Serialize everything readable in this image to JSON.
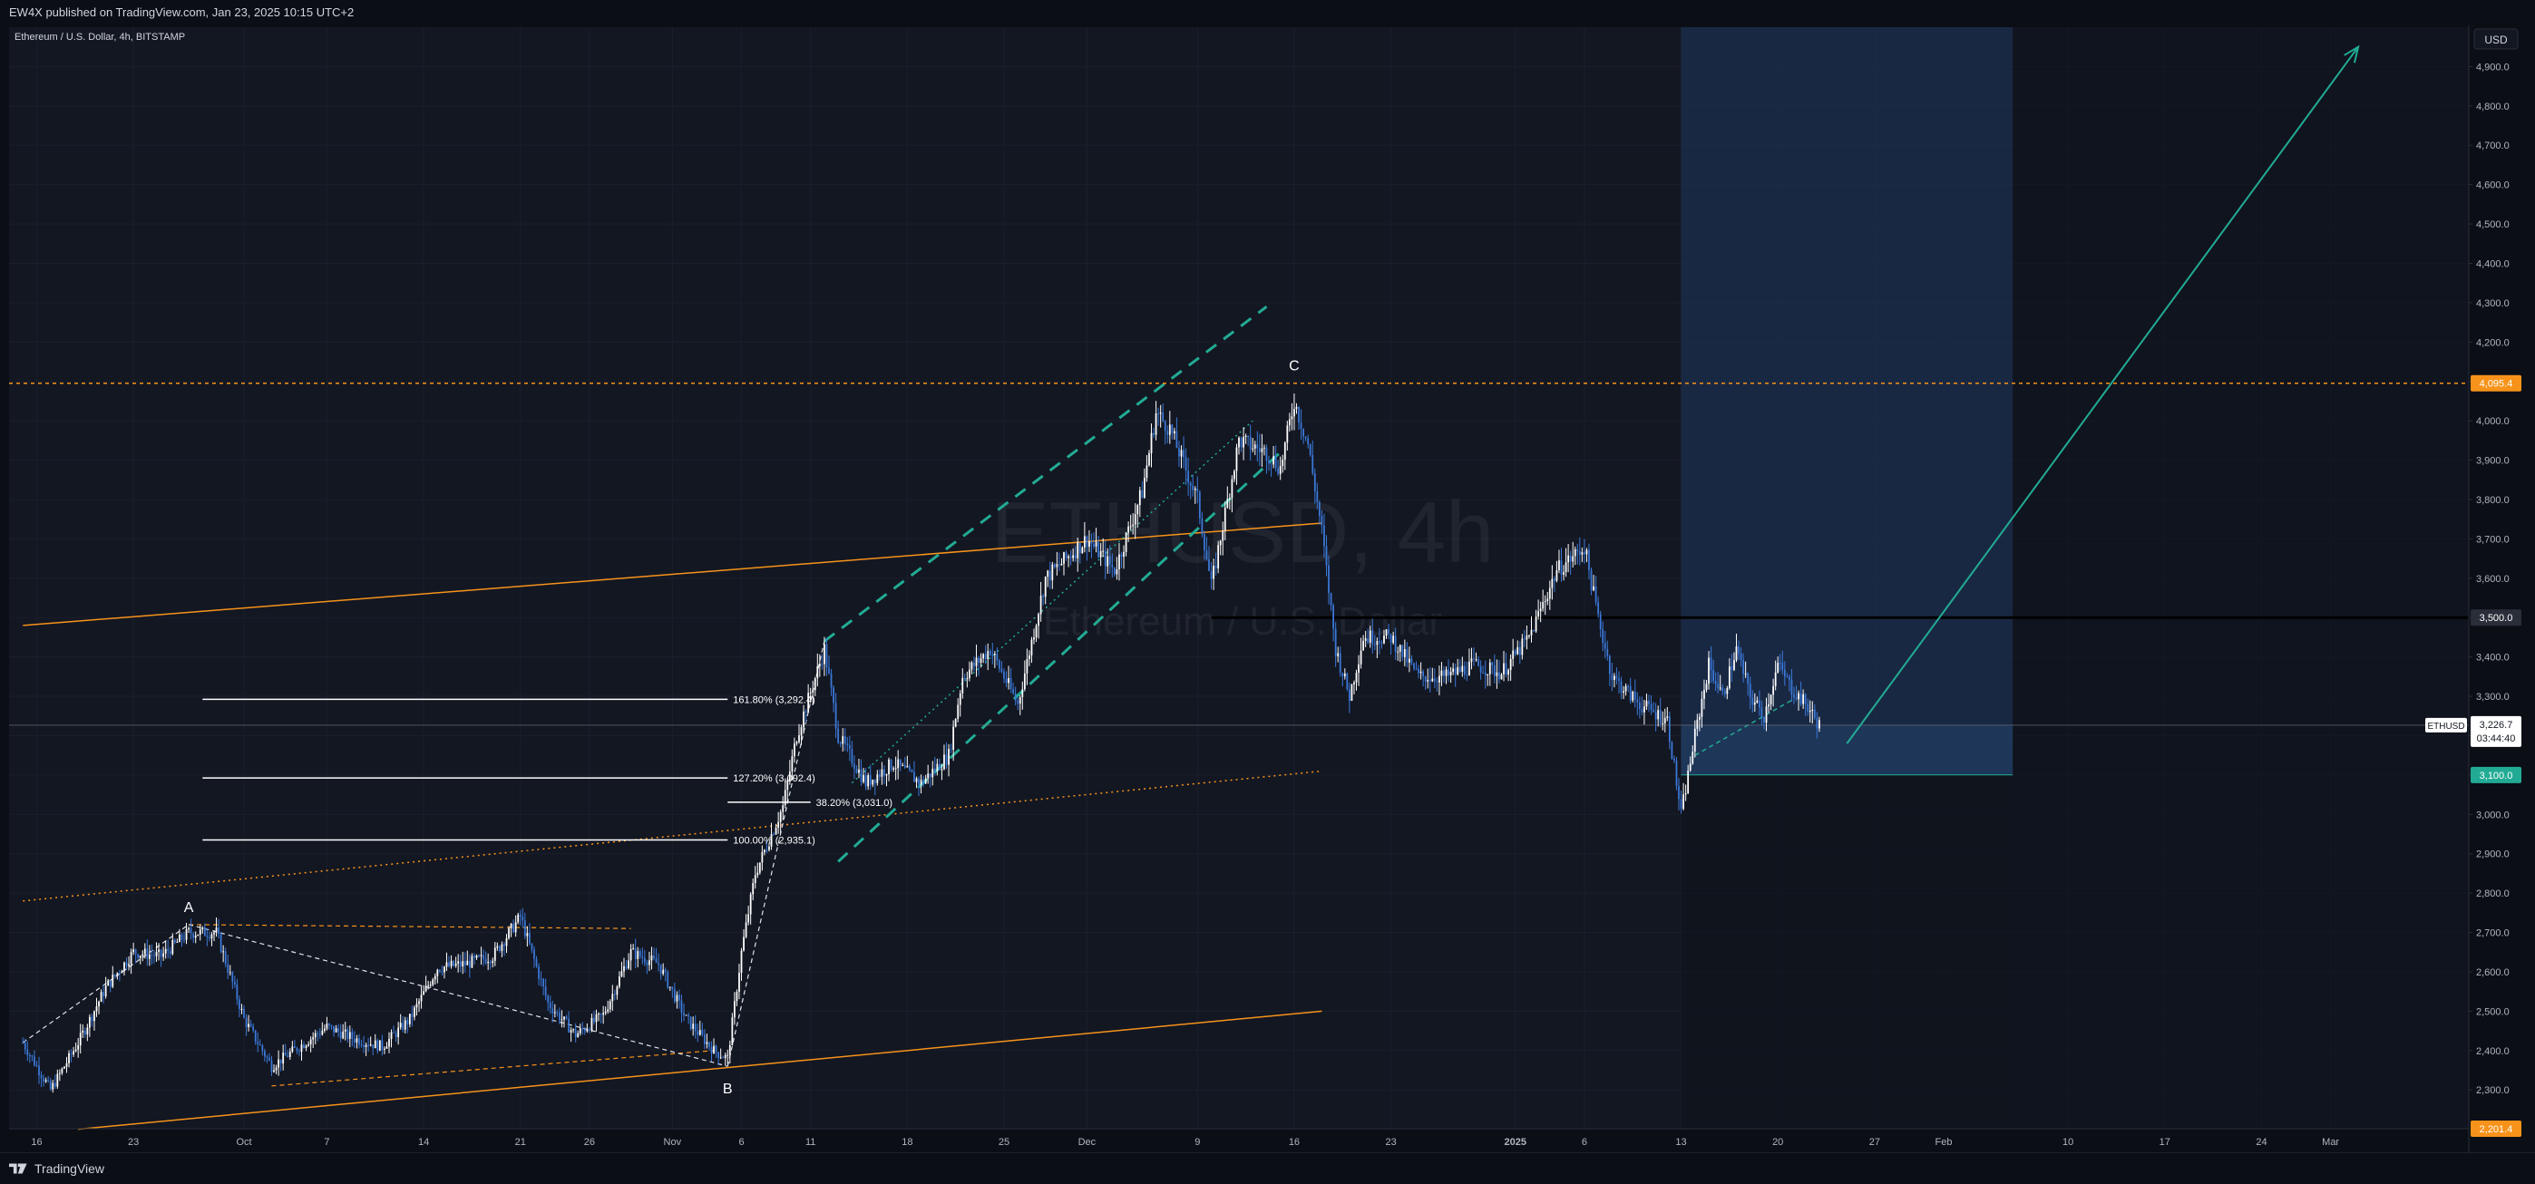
{
  "header": {
    "publish_line": "EW4X published on TradingView.com, Jan 23, 2025 10:15 UTC+2",
    "symbol_legend": "Ethereum / U.S. Dollar, 4h, BITSTAMP"
  },
  "watermark": {
    "ticker": "ETHUSD, 4h",
    "name": "Ethereum / U.S. Dollar"
  },
  "footer": {
    "brand": "TradingView"
  },
  "colors": {
    "background": "#131722",
    "candle": "#ffffff",
    "candle_alt": "#3b78d8",
    "orange": "#f7931a",
    "teal": "#22ab94",
    "grid": "#1a1f2b",
    "zone": "#1c2f4d"
  },
  "chart_data": {
    "type": "candlestick",
    "symbol": "ETHUSD",
    "timeframe": "4h",
    "currency": "USD",
    "ylim": [
      2201.4,
      5000
    ],
    "y_ticks": [
      "2,300.0",
      "2,400.0",
      "2,500.0",
      "2,600.0",
      "2,700.0",
      "2,800.0",
      "2,900.0",
      "3,000.0",
      "3,100.0",
      "3,200.0",
      "3,300.0",
      "3,400.0",
      "3,500.0",
      "3,600.0",
      "3,700.0",
      "3,800.0",
      "3,900.0",
      "4,000.0",
      "4,100.0",
      "4,200.0",
      "4,300.0",
      "4,400.0",
      "4,500.0",
      "4,600.0",
      "4,700.0",
      "4,800.0",
      "4,900.0"
    ],
    "x_ticks": [
      {
        "label": "16",
        "date": "2024-09-16"
      },
      {
        "label": "23",
        "date": "2024-09-23"
      },
      {
        "label": "Oct",
        "date": "2024-10-01"
      },
      {
        "label": "7",
        "date": "2024-10-07"
      },
      {
        "label": "14",
        "date": "2024-10-14"
      },
      {
        "label": "21",
        "date": "2024-10-21"
      },
      {
        "label": "26",
        "date": "2024-10-26"
      },
      {
        "label": "Nov",
        "date": "2024-11-01"
      },
      {
        "label": "6",
        "date": "2024-11-06"
      },
      {
        "label": "11",
        "date": "2024-11-11"
      },
      {
        "label": "18",
        "date": "2024-11-18"
      },
      {
        "label": "25",
        "date": "2024-11-25"
      },
      {
        "label": "Dec",
        "date": "2024-12-01"
      },
      {
        "label": "9",
        "date": "2024-12-09"
      },
      {
        "label": "16",
        "date": "2024-12-16"
      },
      {
        "label": "23",
        "date": "2024-12-23"
      },
      {
        "label": "2025",
        "date": "2025-01-01"
      },
      {
        "label": "6",
        "date": "2025-01-06"
      },
      {
        "label": "13",
        "date": "2025-01-13"
      },
      {
        "label": "20",
        "date": "2025-01-20"
      },
      {
        "label": "27",
        "date": "2025-01-27"
      },
      {
        "label": "Feb",
        "date": "2025-02-01"
      },
      {
        "label": "10",
        "date": "2025-02-10"
      },
      {
        "label": "17",
        "date": "2025-02-17"
      },
      {
        "label": "24",
        "date": "2025-02-24"
      },
      {
        "label": "Mar",
        "date": "2025-03-01"
      }
    ],
    "price_path": [
      [
        "2024-09-15",
        2420
      ],
      [
        "2024-09-17",
        2300
      ],
      [
        "2024-09-19",
        2420
      ],
      [
        "2024-09-21",
        2560
      ],
      [
        "2024-09-23",
        2650
      ],
      [
        "2024-09-25",
        2640
      ],
      [
        "2024-09-27",
        2700
      ],
      [
        "2024-09-29",
        2700
      ],
      [
        "2024-10-01",
        2480
      ],
      [
        "2024-10-03",
        2360
      ],
      [
        "2024-10-05",
        2410
      ],
      [
        "2024-10-07",
        2460
      ],
      [
        "2024-10-09",
        2430
      ],
      [
        "2024-10-11",
        2410
      ],
      [
        "2024-10-13",
        2480
      ],
      [
        "2024-10-15",
        2610
      ],
      [
        "2024-10-17",
        2620
      ],
      [
        "2024-10-19",
        2640
      ],
      [
        "2024-10-21",
        2740
      ],
      [
        "2024-10-23",
        2520
      ],
      [
        "2024-10-25",
        2440
      ],
      [
        "2024-10-27",
        2490
      ],
      [
        "2024-10-29",
        2650
      ],
      [
        "2024-10-31",
        2620
      ],
      [
        "2024-11-02",
        2480
      ],
      [
        "2024-11-04",
        2400
      ],
      [
        "2024-11-05",
        2380
      ],
      [
        "2024-11-06",
        2650
      ],
      [
        "2024-11-07",
        2850
      ],
      [
        "2024-11-09",
        3020
      ],
      [
        "2024-11-10",
        3200
      ],
      [
        "2024-11-12",
        3420
      ],
      [
        "2024-11-13",
        3200
      ],
      [
        "2024-11-15",
        3080
      ],
      [
        "2024-11-17",
        3130
      ],
      [
        "2024-11-19",
        3080
      ],
      [
        "2024-11-21",
        3150
      ],
      [
        "2024-11-22",
        3350
      ],
      [
        "2024-11-24",
        3420
      ],
      [
        "2024-11-26",
        3280
      ],
      [
        "2024-11-28",
        3600
      ],
      [
        "2024-12-01",
        3700
      ],
      [
        "2024-12-03",
        3620
      ],
      [
        "2024-12-05",
        3820
      ],
      [
        "2024-12-06",
        4020
      ],
      [
        "2024-12-07",
        3980
      ],
      [
        "2024-12-09",
        3800
      ],
      [
        "2024-12-10",
        3580
      ],
      [
        "2024-12-12",
        3950
      ],
      [
        "2024-12-14",
        3920
      ],
      [
        "2024-12-15",
        3880
      ],
      [
        "2024-12-16",
        4050
      ],
      [
        "2024-12-17",
        3940
      ],
      [
        "2024-12-18",
        3720
      ],
      [
        "2024-12-19",
        3420
      ],
      [
        "2024-12-20",
        3300
      ],
      [
        "2024-12-21",
        3450
      ],
      [
        "2024-12-23",
        3450
      ],
      [
        "2024-12-25",
        3350
      ],
      [
        "2024-12-27",
        3350
      ],
      [
        "2024-12-29",
        3380
      ],
      [
        "2024-12-31",
        3360
      ],
      [
        "2025-01-02",
        3450
      ],
      [
        "2025-01-04",
        3620
      ],
      [
        "2025-01-06",
        3680
      ],
      [
        "2025-01-07",
        3500
      ],
      [
        "2025-01-08",
        3350
      ],
      [
        "2025-01-10",
        3280
      ],
      [
        "2025-01-12",
        3240
      ],
      [
        "2025-01-13",
        3000
      ],
      [
        "2025-01-14",
        3200
      ],
      [
        "2025-01-15",
        3380
      ],
      [
        "2025-01-16",
        3300
      ],
      [
        "2025-01-17",
        3420
      ],
      [
        "2025-01-18",
        3300
      ],
      [
        "2025-01-19",
        3250
      ],
      [
        "2025-01-20",
        3380
      ],
      [
        "2025-01-21",
        3320
      ],
      [
        "2025-01-22",
        3280
      ],
      [
        "2025-01-23",
        3226.7
      ]
    ],
    "last_price": {
      "symbol": "ETHUSD",
      "value": 3226.7,
      "value_label": "3,226.7",
      "countdown": "03:44:40"
    },
    "price_labels": [
      {
        "value": 4095.4,
        "label": "4,095.4",
        "color": "#f7931a"
      },
      {
        "value": 3500,
        "label": "3,500.0",
        "color": "#2a2e39"
      },
      {
        "value": 3100,
        "label": "3,100.0",
        "color": "#22ab94"
      },
      {
        "value": 2201.4,
        "label": "2,201.4",
        "color": "#f7931a"
      }
    ],
    "horizontal_lines": [
      {
        "value": 4095.4,
        "style": "dashed",
        "color": "#f7931a"
      },
      {
        "value": 3500,
        "style": "solid",
        "color": "#000000",
        "from": "2024-12-10"
      }
    ],
    "wave_labels": [
      {
        "label": "A",
        "date": "2024-09-27",
        "value": 2720
      },
      {
        "label": "B",
        "date": "2024-11-05",
        "value": 2360
      },
      {
        "label": "C",
        "date": "2024-12-16",
        "value": 4095.4
      }
    ],
    "fib_levels": [
      {
        "label": "161.80% (3,292.4)",
        "value": 3292.4,
        "from": "2024-09-28",
        "to": "2024-11-05"
      },
      {
        "label": "127.20% (3,092.4)",
        "value": 3092.4,
        "from": "2024-09-28",
        "to": "2024-11-05"
      },
      {
        "label": "38.20% (3,031.0)",
        "value": 3031.0,
        "from": "2024-11-05",
        "to": "2024-11-11"
      },
      {
        "label": "100.00% (2,935.1)",
        "value": 2935.1,
        "from": "2024-09-28",
        "to": "2024-11-05"
      }
    ],
    "trend_lines": [
      {
        "kind": "orange-solid",
        "from": [
          "2024-09-15",
          3480
        ],
        "to": [
          "2024-12-18",
          3740
        ]
      },
      {
        "kind": "orange-solid",
        "from": [
          "2024-09-19",
          2200
        ],
        "to": [
          "2024-12-18",
          2500
        ]
      },
      {
        "kind": "orange-dotted",
        "from": [
          "2024-09-15",
          2780
        ],
        "to": [
          "2024-12-18",
          3110
        ]
      },
      {
        "kind": "teal-dashed",
        "from": [
          "2024-11-12",
          3440
        ],
        "to": [
          "2024-12-14",
          4290
        ]
      },
      {
        "kind": "teal-dashed",
        "from": [
          "2024-11-13",
          2880
        ],
        "to": [
          "2024-12-15",
          3920
        ]
      },
      {
        "kind": "teal-dotted",
        "from": [
          "2024-11-14",
          3080
        ],
        "to": [
          "2024-12-13",
          4000
        ]
      },
      {
        "kind": "orange-dashed",
        "from": [
          "2024-09-27",
          2720
        ],
        "to": [
          "2024-10-29",
          2710
        ]
      },
      {
        "kind": "orange-dashed",
        "from": [
          "2024-10-03",
          2310
        ],
        "to": [
          "2024-11-04",
          2400
        ]
      },
      {
        "kind": "white-dashed",
        "from": [
          "2024-09-15",
          2420
        ],
        "to": [
          "2024-09-27",
          2720
        ]
      },
      {
        "kind": "white-dashed",
        "from": [
          "2024-09-27",
          2720
        ],
        "to": [
          "2024-11-05",
          2360
        ]
      },
      {
        "kind": "white-dashed",
        "from": [
          "2024-11-05",
          2360
        ],
        "to": [
          "2024-11-12",
          3440
        ]
      },
      {
        "kind": "teal-dashed-short",
        "from": [
          "2025-01-14",
          3150
        ],
        "to": [
          "2025-01-21",
          3290
        ]
      }
    ],
    "projection_arrow": {
      "from": [
        "2025-01-25",
        3180
      ],
      "to": [
        "2025-03-03",
        4950
      ]
    },
    "zone": {
      "from": "2025-01-13",
      "to": "2025-02-06",
      "top": 5000,
      "bottom": 3100,
      "fill_top": 3226.7
    },
    "future_shade": {
      "from": "2025-02-06"
    }
  }
}
